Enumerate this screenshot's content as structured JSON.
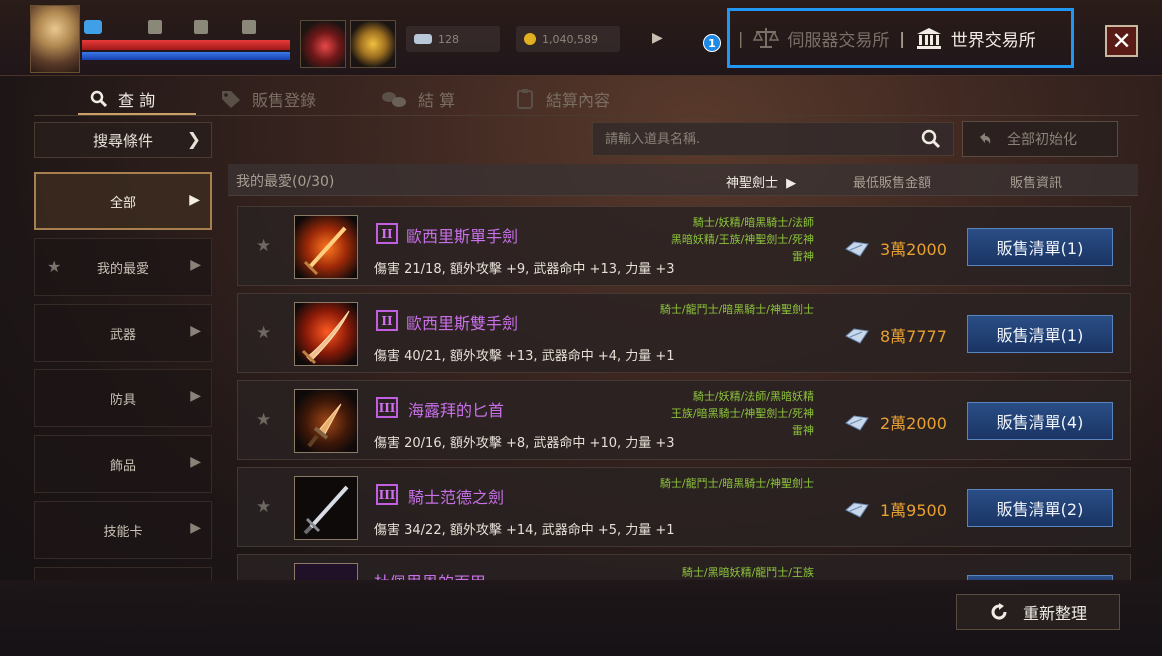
{
  "hud": {
    "currency_1": "128",
    "currency_2": "1,040,589"
  },
  "exchange": {
    "badge": "1",
    "server_exchange_label": "伺服器交易所",
    "world_exchange_label": "世界交易所"
  },
  "tabs": [
    {
      "label": "查 詢",
      "icon": "search-icon",
      "active": true
    },
    {
      "label": "販售登錄",
      "icon": "tag-icon",
      "active": false
    },
    {
      "label": "結 算",
      "icon": "coins-icon",
      "active": false
    },
    {
      "label": "結算內容",
      "icon": "clipboard-icon",
      "active": false
    }
  ],
  "filters": {
    "search_condition_label": "搜尋條件",
    "search_placeholder": "請輸入道具名稱.",
    "reset_label": "全部初始化"
  },
  "sidebar": {
    "items": [
      {
        "label": "全部",
        "active": true
      },
      {
        "label": "我的最愛",
        "active": false
      },
      {
        "label": "武器",
        "active": false
      },
      {
        "label": "防具",
        "active": false
      },
      {
        "label": "飾品",
        "active": false
      },
      {
        "label": "技能卡",
        "active": false
      }
    ]
  },
  "list": {
    "favorites_label": "我的最愛(0/30)",
    "class_filter": "神聖劍士",
    "price_header": "最低販售金額",
    "info_header": "販售資訊",
    "rows": [
      {
        "grade": "II",
        "name": "歐西里斯單手劍",
        "stats": "傷害 21/18, 額外攻擊 +9, 武器命中 +13, 力量 +3",
        "classes": [
          "騎士/妖精/暗黑騎士/法師",
          "黑暗妖精/王族/神聖劍士/死神",
          "雷神"
        ],
        "price": "3萬2000",
        "button": "販售清單(1)"
      },
      {
        "grade": "II",
        "name": "歐西里斯雙手劍",
        "stats": "傷害 40/21, 額外攻擊 +13, 武器命中 +4, 力量 +1",
        "classes": [
          "騎士/龍鬥士/暗黑騎士/神聖劍士"
        ],
        "price": "8萬7777",
        "button": "販售清單(1)"
      },
      {
        "grade": "III",
        "name": "海露拜的匕首",
        "stats": "傷害 20/16, 額外攻擊 +8, 武器命中 +10, 力量 +3",
        "classes": [
          "騎士/妖精/法師/黑暗妖精",
          "王族/暗黑騎士/神聖劍士/死神",
          "雷神"
        ],
        "price": "2萬2000",
        "button": "販售清單(4)"
      },
      {
        "grade": "III",
        "name": "騎士范德之劍",
        "stats": "傷害 34/22, 額外攻擊 +14, 武器命中 +5, 力量 +1",
        "classes": [
          "騎士/龍鬥士/暗黑騎士/神聖劍士"
        ],
        "price": "1萬9500",
        "button": "販售清單(2)"
      }
    ],
    "partial_row": {
      "name": "杜佩里恩的面甲",
      "classes": "騎士/黑暗妖精/龍鬥士/王族"
    }
  },
  "refresh_label": "重新整理",
  "colors": {
    "highlight_box": "#2196f3",
    "item_name": "#c870e8",
    "class_text": "#8cc43c",
    "price": "#e8a030",
    "sale_button": "#1a3464"
  }
}
